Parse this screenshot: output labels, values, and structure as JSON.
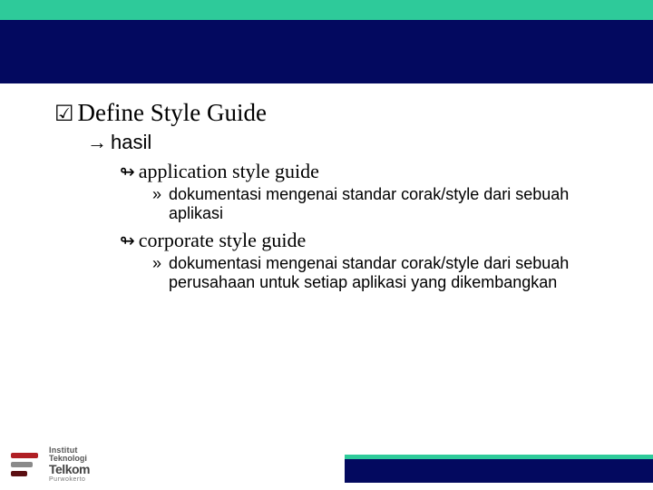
{
  "content": {
    "lvl1": {
      "bullet": "☑",
      "text": "Define Style Guide"
    },
    "lvl2": {
      "bullet": "→",
      "text": "hasil"
    },
    "items": [
      {
        "bullet": "↬",
        "title": "application style guide",
        "sub": {
          "bullet": "»",
          "text": "dokumentasi mengenai standar corak/style dari sebuah aplikasi"
        }
      },
      {
        "bullet": "↬",
        "title": "corporate style guide",
        "sub": {
          "bullet": "»",
          "text": "dokumentasi mengenai standar corak/style dari sebuah perusahaan untuk setiap aplikasi yang dikembangkan"
        }
      }
    ]
  },
  "logo": {
    "line1": "Institut",
    "line2": "Teknologi",
    "line3": "Telkom",
    "line4": "Purwokerto"
  }
}
